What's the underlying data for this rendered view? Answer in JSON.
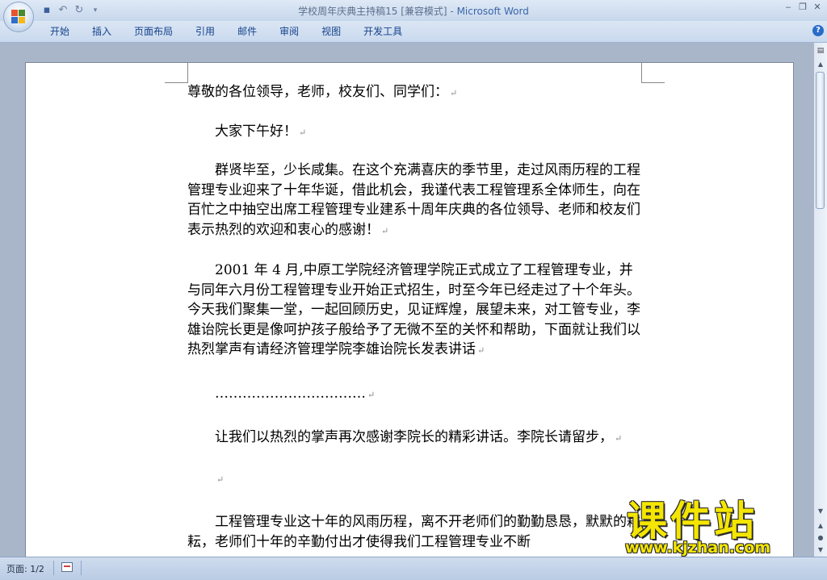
{
  "window": {
    "title": "学校周年庆典主持稿15 [兼容模式] - ",
    "app_name": "Microsoft Word",
    "controls": [
      "‒",
      "❐",
      "✕"
    ]
  },
  "quick_access": {
    "save_icon": "save-icon",
    "undo_icon": "undo-icon",
    "redo_icon": "redo-icon",
    "customize_icon": "customize-icon"
  },
  "ribbon": {
    "tabs": [
      "开始",
      "插入",
      "页面布局",
      "引用",
      "邮件",
      "审阅",
      "视图",
      "开发工具"
    ],
    "help_label": "?"
  },
  "document": {
    "paragraphs": [
      "尊敬的各位领导，老师，校友们、同学们：",
      "大家下午好！",
      "群贤毕至，少长咸集。在这个充满喜庆的季节里，走过风雨历程的工程管理专业迎来了十年华诞，借此机会，我谨代表工程管理系全体师生，向在百忙之中抽空出席工程管理专业建系十周年庆典的各位领导、老师和校友们表示热烈的欢迎和衷心的感谢！",
      " 2001 年 4 月,中原工学院经济管理学院正式成立了工程管理专业，并与同年六月份工程管理专业开始正式招生，时至今年已经走过了十个年头。今天我们聚集一堂，一起回顾历史，见证辉煌，展望未来，对工管专业，李雄诒院长更是像呵护孩子般给予了无微不至的关怀和帮助，下面就让我们以热烈掌声有请经济管理学院李雄诒院长发表讲话",
      "……………………………",
      "让我们以热烈的掌声再次感谢李院长的精彩讲话。李院长请留步，",
      "",
      "工程管理专业这十年的风雨历程，离不开老师们的勤勤恳恳，默默的耕耘，老师们十年的辛勤付出才使得我们工程管理专业不断"
    ],
    "paragraph_mark": "↵"
  },
  "statusbar": {
    "page_label": "页面: 1/2"
  },
  "watermark": {
    "text": "课件站",
    "url": "www.kjzhan.com"
  },
  "colors": {
    "ribbon_text": "#15428b",
    "title_app": "#3a66a8",
    "watermark": "#f4e600",
    "office_logo": [
      "#e8542f",
      "#4a8a2e",
      "#2f6fc7",
      "#f3b81b"
    ]
  }
}
